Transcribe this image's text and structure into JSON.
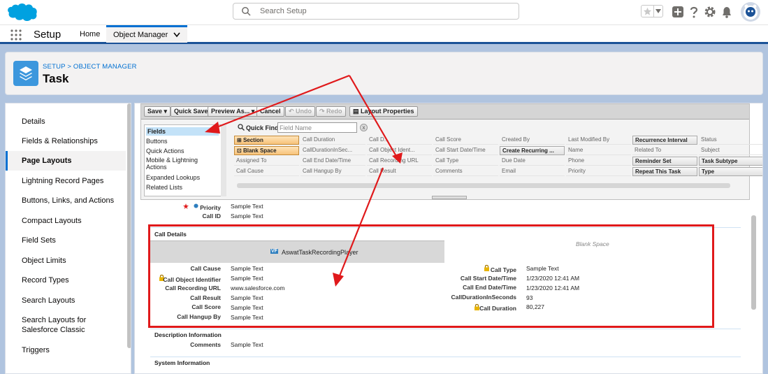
{
  "header": {
    "search_placeholder": "Search Setup"
  },
  "nav": {
    "app_name": "Setup",
    "tabs": [
      {
        "label": "Home"
      },
      {
        "label": "Object Manager"
      }
    ]
  },
  "page": {
    "breadcrumb": "SETUP > OBJECT MANAGER",
    "title": "Task"
  },
  "sidebar": {
    "items": [
      {
        "label": "Details"
      },
      {
        "label": "Fields & Relationships"
      },
      {
        "label": "Page Layouts"
      },
      {
        "label": "Lightning Record Pages"
      },
      {
        "label": "Buttons, Links, and Actions"
      },
      {
        "label": "Compact Layouts"
      },
      {
        "label": "Field Sets"
      },
      {
        "label": "Object Limits"
      },
      {
        "label": "Record Types"
      },
      {
        "label": "Search Layouts"
      },
      {
        "label": "Search Layouts for Salesforce Classic"
      },
      {
        "label": "Triggers"
      }
    ],
    "active_index": 2
  },
  "toolbar": {
    "save": "Save",
    "quick_save": "Quick Save",
    "preview_as": "Preview As...",
    "cancel": "Cancel",
    "undo": "Undo",
    "redo": "Redo",
    "layout_properties": "Layout Properties"
  },
  "palette": {
    "categories": [
      "Fields",
      "Buttons",
      "Quick Actions",
      "Mobile & Lightning Actions",
      "Expanded Lookups",
      "Related Lists"
    ],
    "quick_find_label": "Quick Find",
    "quick_find_placeholder": "Field Name",
    "clear_label": "x",
    "fields": [
      [
        "Section",
        "Call Duration",
        "Call D...",
        "Call Score",
        "Created By",
        "Last Modified By",
        "Recurrence Interval",
        "Status"
      ],
      [
        "Blank Space",
        "CallDurationInSec...",
        "Call Object Ident...",
        "Call Start Date/Time",
        "Create Recurring ...",
        "Name",
        "Related To",
        "Subject"
      ],
      [
        "Assigned To",
        "Call End Date/Time",
        "Call Recording URL",
        "Call Type",
        "Due Date",
        "Phone",
        "Reminder Set",
        "Task Subtype"
      ],
      [
        "Call Cause",
        "Call Hangup By",
        "Call Result",
        "Comments",
        "Email",
        "Priority",
        "Repeat This Task",
        "Type"
      ]
    ]
  },
  "layout": {
    "top_fields": [
      {
        "label": "Priority",
        "value": "Sample Text"
      },
      {
        "label": "Call ID",
        "value": "Sample Text"
      }
    ],
    "call_details": {
      "title": "Call Details",
      "vf_badge": "VF",
      "vf_page": "AswatTaskRecordingPlayer",
      "blank_space": "Blank Space",
      "left": [
        {
          "label": "Call Cause",
          "value": "Sample Text"
        },
        {
          "label": "Call Object Identifier",
          "value": "Sample Text"
        },
        {
          "label": "Call Recording URL",
          "value": "www.salesforce.com"
        },
        {
          "label": "Call Result",
          "value": "Sample Text"
        },
        {
          "label": "Call Score",
          "value": "Sample Text"
        },
        {
          "label": "Call Hangup By",
          "value": "Sample Text"
        }
      ],
      "right": [
        {
          "label": "Call Type",
          "value": "Sample Text"
        },
        {
          "label": "Call Start Date/Time",
          "value": "1/23/2020 12:41 AM"
        },
        {
          "label": "Call End Date/Time",
          "value": "1/23/2020 12:41 AM"
        },
        {
          "label": "CallDurationInSeconds",
          "value": "93"
        },
        {
          "label": "Call Duration",
          "value": "80,227"
        }
      ]
    },
    "description": {
      "title": "Description Information",
      "fields": [
        {
          "label": "Comments",
          "value": "Sample Text"
        }
      ]
    },
    "system": {
      "title": "System Information"
    }
  },
  "colors": {
    "brand_blue": "#0070d2",
    "annotation_red": "#e0191b",
    "page_bg": "#b0c4df",
    "field_orange": "#f7c27a"
  }
}
